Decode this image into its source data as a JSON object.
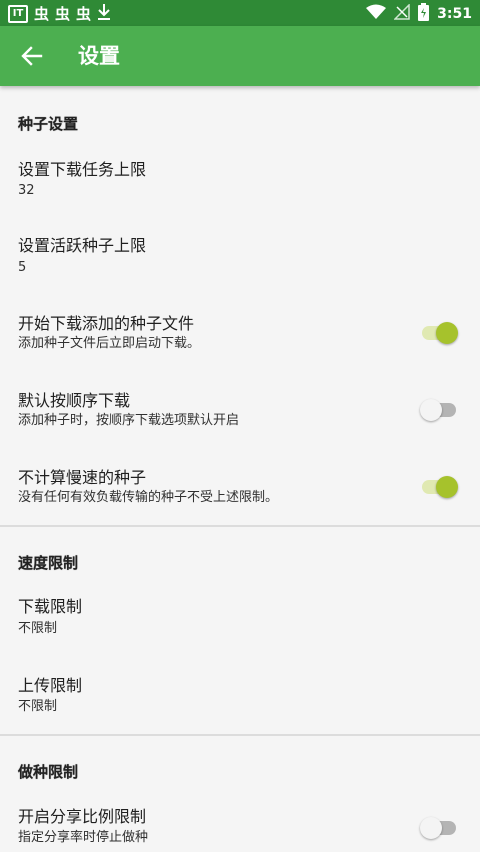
{
  "status_bar": {
    "left_icons": [
      "app-badge-icon",
      "bug-icon",
      "bug-icon",
      "bug-icon",
      "download-icon"
    ],
    "time": "3:51",
    "right_icons": [
      "wifi-icon",
      "no-signal-icon",
      "battery-icon"
    ]
  },
  "app_bar": {
    "title": "设置",
    "back_icon": "arrow-back-icon",
    "background": "#4caf50"
  },
  "sections": [
    {
      "header": "种子设置",
      "items": [
        {
          "title": "设置下载任务上限",
          "summary": "32"
        },
        {
          "title": "设置活跃种子上限",
          "summary": "5"
        },
        {
          "title": "开始下载添加的种子文件",
          "summary": "添加种子文件后立即启动下载。",
          "switch": true
        },
        {
          "title": "默认按顺序下载",
          "summary": "添加种子时，按顺序下载选项默认开启",
          "switch": false
        },
        {
          "title": "不计算慢速的种子",
          "summary": "没有任何有效负载传输的种子不受上述限制。",
          "switch": true
        }
      ]
    },
    {
      "header": "速度限制",
      "items": [
        {
          "title": "下载限制",
          "summary": "不限制"
        },
        {
          "title": "上传限制",
          "summary": "不限制"
        }
      ]
    },
    {
      "header": "做种限制",
      "items": [
        {
          "title": "开启分享比例限制",
          "summary": "指定分享率时停止做种",
          "switch": false
        }
      ]
    }
  ],
  "colors": {
    "switch_on_thumb": "#a6c22c",
    "switch_on_track": "#e0e9b2",
    "switch_off_thumb": "#f4f4f4",
    "switch_off_track": "#b4b4b4"
  }
}
